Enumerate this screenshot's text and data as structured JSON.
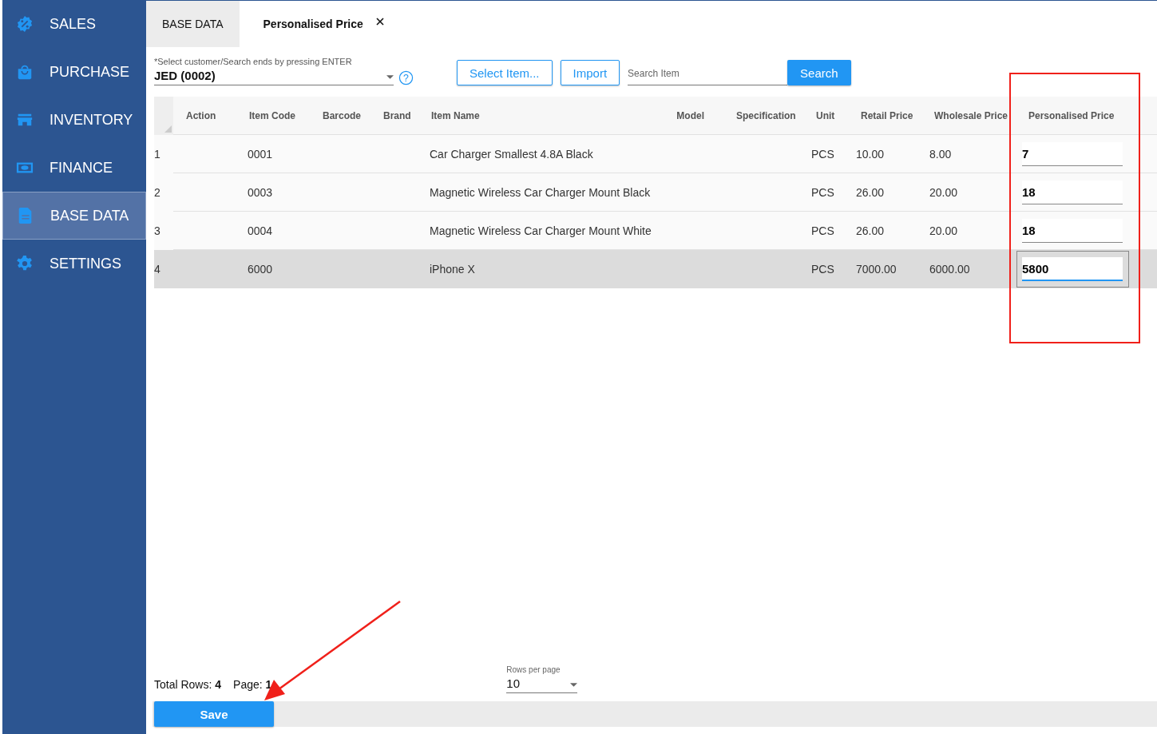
{
  "sidebar": {
    "items": [
      {
        "label": "SALES",
        "kind": "sales",
        "selected": false
      },
      {
        "label": "PURCHASE",
        "kind": "purchase",
        "selected": false
      },
      {
        "label": "INVENTORY",
        "kind": "inventory",
        "selected": false
      },
      {
        "label": "FINANCE",
        "kind": "finance",
        "selected": false
      },
      {
        "label": "BASE DATA",
        "kind": "document",
        "selected": true
      },
      {
        "label": "SETTINGS",
        "kind": "settings",
        "selected": false
      }
    ]
  },
  "tabs": [
    {
      "label": "BASE DATA",
      "selected": false,
      "closable": false
    },
    {
      "label": "Personalised Price",
      "selected": true,
      "closable": true
    }
  ],
  "customer_field": {
    "label": "*Select customer/Search ends by pressing ENTER",
    "value": "JED (0002)"
  },
  "help_icon": "?",
  "buttons": [
    "Select Item...",
    "Import"
  ],
  "search_field": {
    "placeholder": "Search Item"
  },
  "search_button": "Search",
  "table": {
    "columns": [
      "Action",
      "Item Code",
      "Barcode",
      "Brand",
      "Item Name",
      "Model",
      "Specification",
      "Unit",
      "Retail Price",
      "Wholesale Price",
      "Personalised Price"
    ],
    "rows": [
      {
        "index": "1",
        "item_code": "0001",
        "item_name": "Car Charger  Smallest 4.8A Black",
        "unit": "PCS",
        "retail_price": "10.00",
        "wholesale_price": "8.00",
        "personalised_price": "7",
        "selected": false,
        "focused": false
      },
      {
        "index": "2",
        "item_code": "0003",
        "item_name": "Magnetic Wireless Car Charger Mount Black",
        "unit": "PCS",
        "retail_price": "26.00",
        "wholesale_price": "20.00",
        "personalised_price": "18",
        "selected": false,
        "focused": false
      },
      {
        "index": "3",
        "item_code": "0004",
        "item_name": "Magnetic Wireless Car Charger Mount White",
        "unit": "PCS",
        "retail_price": "26.00",
        "wholesale_price": "20.00",
        "personalised_price": "18",
        "selected": false,
        "focused": false
      },
      {
        "index": "4",
        "item_code": "6000",
        "item_name": "iPhone X",
        "unit": "PCS",
        "retail_price": "7000.00",
        "wholesale_price": "6000.00",
        "personalised_price": "5800",
        "selected": true,
        "focused": true
      }
    ]
  },
  "footer": {
    "total_rows": "Total Rows: **4**",
    "page": "Page: **1**",
    "rows_per_page_label": "Rows per page",
    "rows_per_page": "10"
  },
  "save_button": "Save"
}
